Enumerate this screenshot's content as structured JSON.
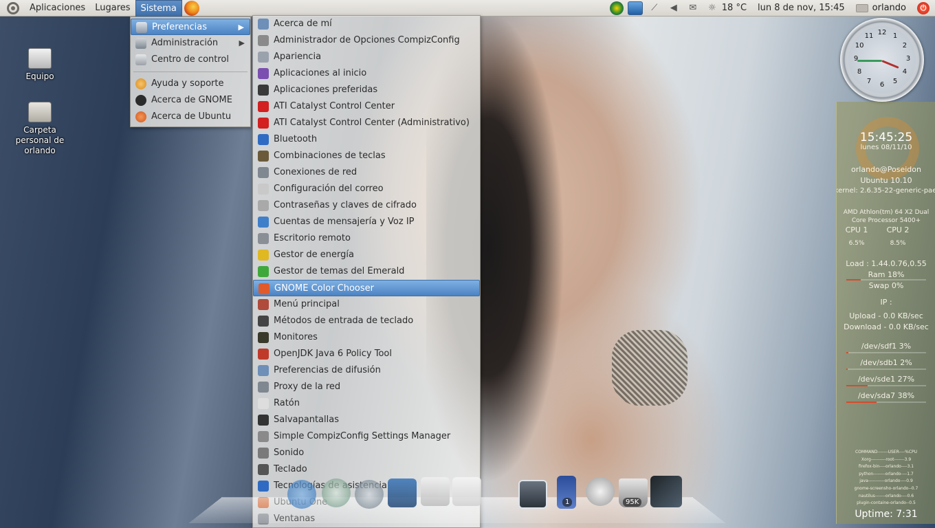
{
  "top_panel": {
    "menus": [
      "Aplicaciones",
      "Lugares",
      "Sistema"
    ],
    "weather": "18 °C",
    "datetime": "lun  8 de nov, 15:45",
    "user": "orlando"
  },
  "desktop_icons": [
    {
      "label": "Equipo"
    },
    {
      "label": "Carpeta personal de orlando"
    }
  ],
  "sistema_menu": {
    "items": [
      {
        "label": "Preferencias",
        "icon": "preferences-icon",
        "submenu": true
      },
      {
        "label": "Administración",
        "icon": "administration-icon",
        "submenu": true
      },
      {
        "label": "Centro de control",
        "icon": "control-center-icon",
        "submenu": false
      },
      {
        "label": "Ayuda y soporte",
        "icon": "help-icon",
        "submenu": false
      },
      {
        "label": "Acerca de GNOME",
        "icon": "gnome-icon",
        "submenu": false
      },
      {
        "label": "Acerca de Ubuntu",
        "icon": "ubuntu-icon",
        "submenu": false
      }
    ]
  },
  "preferences_menu": {
    "items": [
      {
        "label": "Acerca de mí",
        "color": "#6d8fb8"
      },
      {
        "label": "Administrador de Opciones CompizConfig",
        "color": "#8a8a8a"
      },
      {
        "label": "Apariencia",
        "color": "#9aa3ad"
      },
      {
        "label": "Aplicaciones al inicio",
        "color": "#7a4fb0"
      },
      {
        "label": "Aplicaciones preferidas",
        "color": "#3a3a3a"
      },
      {
        "label": "ATI Catalyst Control Center",
        "color": "#d32020"
      },
      {
        "label": "ATI Catalyst Control Center (Administrativo)",
        "color": "#d32020"
      },
      {
        "label": "Bluetooth",
        "color": "#2f6bc2"
      },
      {
        "label": "Combinaciones de teclas",
        "color": "#6b5a3a"
      },
      {
        "label": "Conexiones de red",
        "color": "#7f8790"
      },
      {
        "label": "Configuración del correo",
        "color": "#c9c9c9"
      },
      {
        "label": "Contraseñas y claves de cifrado",
        "color": "#a9a9a9"
      },
      {
        "label": "Cuentas de mensajería y Voz IP",
        "color": "#3f7fc9"
      },
      {
        "label": "Escritorio remoto",
        "color": "#8a8f96"
      },
      {
        "label": "Gestor de energía",
        "color": "#e0b822"
      },
      {
        "label": "Gestor de temas del Emerald",
        "color": "#3fa83a"
      },
      {
        "label": "GNOME Color Chooser",
        "color": "#e05a2a"
      },
      {
        "label": "Menú principal",
        "color": "#b04a3a"
      },
      {
        "label": "Métodos de entrada de teclado",
        "color": "#444444"
      },
      {
        "label": "Monitores",
        "color": "#3a3a2a"
      },
      {
        "label": "OpenJDK Java 6 Policy Tool",
        "color": "#c03a2a"
      },
      {
        "label": "Preferencias de difusión",
        "color": "#6d8fb8"
      },
      {
        "label": "Proxy de la red",
        "color": "#7f8790"
      },
      {
        "label": "Ratón",
        "color": "#dddddd"
      },
      {
        "label": "Salvapantallas",
        "color": "#333333"
      },
      {
        "label": "Simple CompizConfig Settings Manager",
        "color": "#8a8a8a"
      },
      {
        "label": "Sonido",
        "color": "#7a7a7a"
      },
      {
        "label": "Teclado",
        "color": "#555555"
      },
      {
        "label": "Tecnologías de asistencia",
        "color": "#2f6bc2"
      },
      {
        "label": "Ubuntu One",
        "color": "#c8541a"
      },
      {
        "label": "Ventanas",
        "color": "#8a8f96"
      }
    ],
    "highlighted": "GNOME Color Chooser"
  },
  "dock": {
    "workspace_badge": "1",
    "trash_badge": "95K"
  },
  "clock": {
    "numbers": [
      "12",
      "1",
      "2",
      "3",
      "4",
      "5",
      "6",
      "7",
      "8",
      "9",
      "10",
      "11"
    ],
    "time": "15:45"
  },
  "conky": {
    "time": "15:45:25",
    "date": "lunes 08/11/10",
    "host": "orlando@Poseidon",
    "distro": "Ubuntu 10.10",
    "kernel": "kernel: 2.6.35-22-generic-pae",
    "cpu_name": "AMD Athlon(tm) 64 X2 Dual Core Processor 5400+",
    "cpu1_label": "CPU 1",
    "cpu2_label": "CPU 2",
    "cpu1": "6.5%",
    "cpu2": "8.5%",
    "load": "Load : 1.44.0.76,0.55",
    "ram": "Ram 18%",
    "swap": "Swap 0%",
    "ip": "IP :",
    "upload": "Upload - 0.0 KB/sec",
    "download": "Download - 0.0 KB/sec",
    "disks": [
      {
        "label": "/dev/sdf1 3%",
        "fill": 0.03
      },
      {
        "label": "/dev/sdb1 2%",
        "fill": 0.02
      },
      {
        "label": "/dev/sde1 27%",
        "fill": 0.27
      },
      {
        "label": "/dev/sda7 38%",
        "fill": 0.38
      }
    ],
    "ram_fill": 0.18,
    "processes": [
      "COMMAND-------USER----%CPU",
      "Xorg----------root-------3.9",
      "firefox-bin----orlando----3.1",
      "python--------orlando----1.7",
      "java-----------orlando----0.9",
      "gnome-screensho-orlando--0.7",
      "nautilus-------orlando----0.6",
      "plugin-containe-orlando--0.5"
    ],
    "uptime": "Uptime: 7:31"
  }
}
